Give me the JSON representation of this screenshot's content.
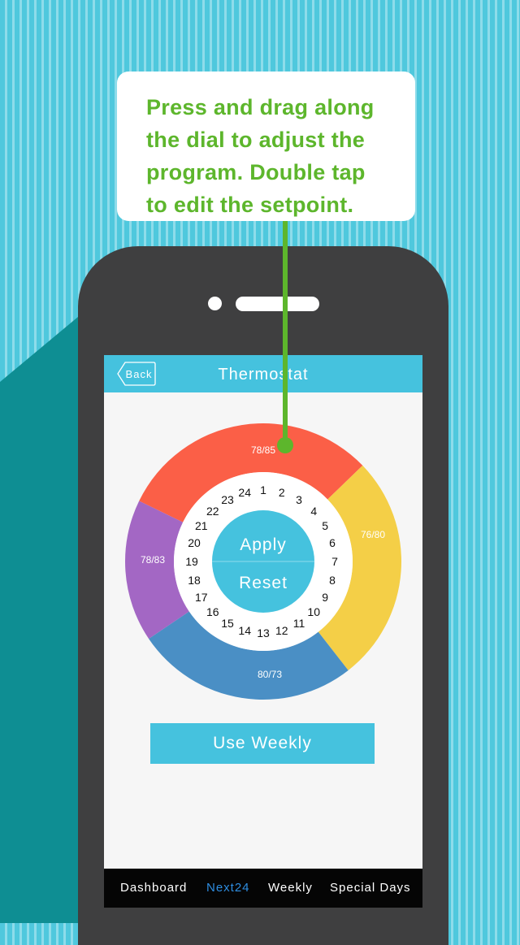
{
  "callout": {
    "lines": [
      "Press and drag along",
      "the dial to adjust the",
      "program. Double tap",
      "to edit the setpoint."
    ]
  },
  "app": {
    "title": "Thermostat",
    "back_label": "Back"
  },
  "dial": {
    "segments": [
      {
        "label": "78/85",
        "color": "#fb5f47"
      },
      {
        "label": "76/80",
        "color": "#f4cf47"
      },
      {
        "label": "80/73",
        "color": "#4a8fc5"
      },
      {
        "label": "78/83",
        "color": "#a367c4"
      }
    ],
    "hours": [
      "1",
      "2",
      "3",
      "4",
      "5",
      "6",
      "7",
      "8",
      "9",
      "10",
      "11",
      "12",
      "13",
      "14",
      "15",
      "16",
      "17",
      "18",
      "19",
      "20",
      "21",
      "22",
      "23",
      "24"
    ],
    "apply_label": "Apply",
    "reset_label": "Reset"
  },
  "use_weekly_label": "Use Weekly",
  "tabs": [
    {
      "label": "Dashboard",
      "active": false
    },
    {
      "label": "Next24",
      "active": true
    },
    {
      "label": "Weekly",
      "active": false
    },
    {
      "label": "Special Days",
      "active": false
    }
  ],
  "colors": {
    "accent": "#45c2de",
    "callout_text": "#5db62c",
    "phone_body": "#3f3f40",
    "active_tab": "#2e8de0"
  }
}
